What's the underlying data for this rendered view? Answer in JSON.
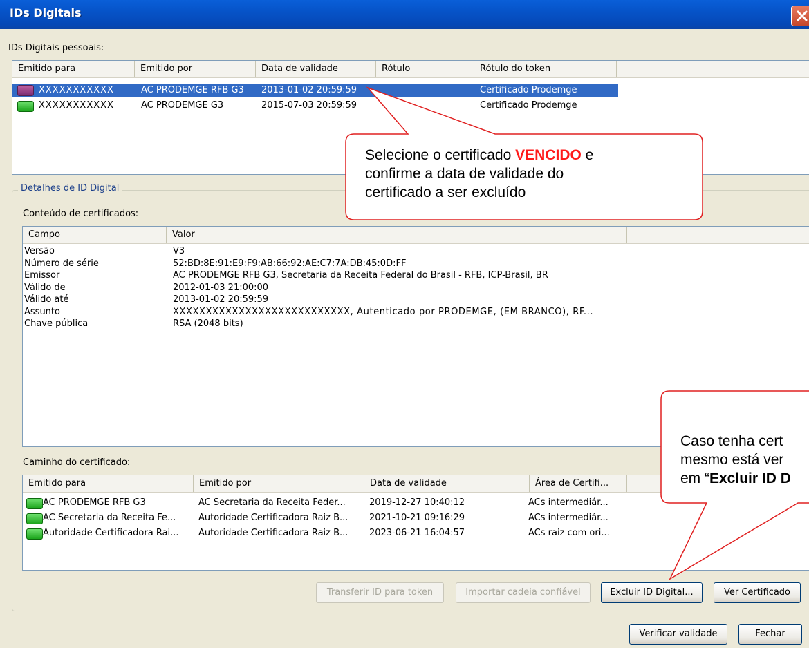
{
  "window": {
    "title": "IDs Digitais"
  },
  "personal": {
    "label": "IDs Digitais pessoais:",
    "columns": [
      "Emitido para",
      "Emitido por",
      "Data de validade",
      "Rótulo",
      "Rótulo do token"
    ],
    "rows": [
      {
        "issued_to": "XXXXXXXXXXX",
        "issued_by": "AC PRODEMGE RFB G3",
        "validity": "2013-01-02 20:59:59",
        "label": "",
        "token_label": "Certificado Prodemge",
        "icon": "expired-certificate-token-icon"
      },
      {
        "issued_to": "XXXXXXXXXXX",
        "issued_by": "AC PRODEMGE G3",
        "validity": "2015-07-03 20:59:59",
        "label": "",
        "token_label": "Certificado Prodemge",
        "icon": "valid-certificate-token-icon"
      }
    ]
  },
  "details": {
    "group_label": "Detalhes de ID Digital",
    "contents_label": "Conteúdo de certificados:",
    "columns": [
      "Campo",
      "Valor"
    ],
    "fields": [
      {
        "name": "Versão",
        "value": "V3"
      },
      {
        "name": "Número de série",
        "value": "52:BD:8E:91:E9:F9:AB:66:92:AE:C7:7A:DB:45:0D:FF"
      },
      {
        "name": "Emissor",
        "value": "AC PRODEMGE RFB G3, Secretaria da Receita Federal do Brasil - RFB, ICP-Brasil, BR"
      },
      {
        "name": "Válido de",
        "value": "2012-01-03 21:00:00"
      },
      {
        "name": "Válido até",
        "value": "2013-01-02 20:59:59"
      },
      {
        "name": "Assunto",
        "value": "XXXXXXXXXXXXXXXXXXXXXXXXXXX, Autenticado por PRODEMGE, (EM BRANCO), RF..."
      },
      {
        "name": "Chave pública",
        "value": "RSA (2048 bits)"
      }
    ],
    "path_label": "Caminho do certificado:",
    "path_columns": [
      "Emitido para",
      "Emitido por",
      "Data de validade",
      "Área de Certifi..."
    ],
    "path_rows": [
      {
        "issued_to": "AC PRODEMGE RFB G3",
        "issued_by": "AC Secretaria da Receita Feder...",
        "validity": "2019-12-27 10:40:12",
        "area": "ACs intermediár..."
      },
      {
        "issued_to": "AC Secretaria da Receita Fe...",
        "issued_by": "Autoridade Certificadora Raiz B...",
        "validity": "2021-10-21 09:16:29",
        "area": "ACs intermediár..."
      },
      {
        "issued_to": "Autoridade Certificadora Rai...",
        "issued_by": "Autoridade Certificadora Raiz B...",
        "validity": "2023-06-21 16:04:57",
        "area": "ACs raiz com ori..."
      }
    ]
  },
  "buttons": {
    "transfer": "Transferir ID para token",
    "import_chain": "Importar cadeia confiável",
    "delete_id": "Excluir ID Digital...",
    "view_cert": "Ver Certificado",
    "verify": "Verificar validade",
    "close": "Fechar"
  },
  "callout1": {
    "line1_before": "Selecione o certificado ",
    "line1_highlight": "VENCIDO",
    "line1_after": " e",
    "line2": "confirme a data de validade do",
    "line3": "certificado a ser excluído"
  },
  "callout2": {
    "line1": "Caso tenha cert",
    "line2": "mesmo está ver",
    "line3_before": "em “",
    "line3_bold": "Excluir ID D"
  },
  "colors": {
    "selection": "#316ac5",
    "callout_border": "#e02020",
    "highlight_text": "#ff1a1a",
    "titlebar": "#0653c8"
  }
}
